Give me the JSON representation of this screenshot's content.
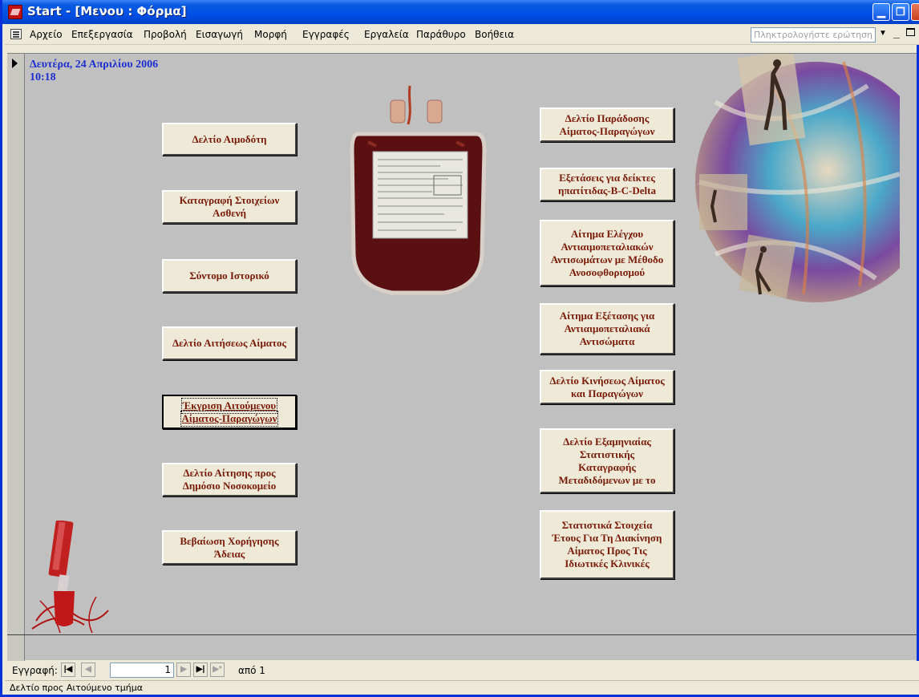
{
  "window": {
    "title": "Start - [Μενου : Φόρμα]",
    "minimize_icon": "minimize-icon",
    "restore_icon": "restore-icon",
    "close_icon": "close-icon"
  },
  "menu": {
    "items": [
      "Αρχείο",
      "Επεξεργασία",
      "Προβολή",
      "Εισαγωγή",
      "Μορφή",
      "Εγγραφές",
      "Εργαλεία",
      "Παράθυρο",
      "Βοήθεια"
    ],
    "help_placeholder": "Πληκτρολογήστε ερώτηση"
  },
  "form": {
    "date": "Δευτέρα, 24 Απριλίου 2006",
    "time": "10:18",
    "left_buttons": [
      [
        "Δελτίο Αιμοδότη"
      ],
      [
        "Καταγραφή Στοιχείων",
        "Ασθενή"
      ],
      [
        "Σύντομο Ιστορικό"
      ],
      [
        "Δελτίο Αιτήσεως Αίματος"
      ],
      [
        "Έκγριση Αιτούμενου",
        "Αίματος-Παραγώγων"
      ],
      [
        "Δελτίο Αίτησης προς",
        "Δημόσιο Νοσοκομείο"
      ],
      [
        "Βεβαίωση Χορήγησης",
        "Άδειας"
      ]
    ],
    "right_buttons": [
      [
        "Δελτίο Παράδοσης",
        "Αίματος-Παραγώγων"
      ],
      [
        "Εξετάσεις για δείκτες",
        "ηπατίτιδας-B-C-Delta"
      ],
      [
        "Αίτημα Ελέγχου",
        "Αντιαιμοπεταλιακών",
        "Αντισωμάτων με Μέθοδο",
        "Ανοσοφθορισμού"
      ],
      [
        "Αίτημα Εξέτασης για",
        "Αντιαιμοπεταλιακά",
        "Αντισώματα"
      ],
      [
        "Δελτίο Κινήσεως Αίματος",
        "και Παραγώγων"
      ],
      [
        "Δελτίο Εξαμηνιαίας",
        "Στατιστικής",
        "Καταγραφής",
        "Μεταδιδόμενων με το"
      ],
      [
        "Στατιστικά Στοιχεία",
        "Έτους Για Τη Διακίνηση",
        "Αίματος Προς Τις",
        "Ιδιωτικές Κλινικές"
      ]
    ]
  },
  "navigation": {
    "label": "Εγγραφή:",
    "current_record": "1",
    "of_text": "από 1"
  },
  "status": {
    "text": "Δελτίο προς Αιτούμενο τμήμα"
  }
}
